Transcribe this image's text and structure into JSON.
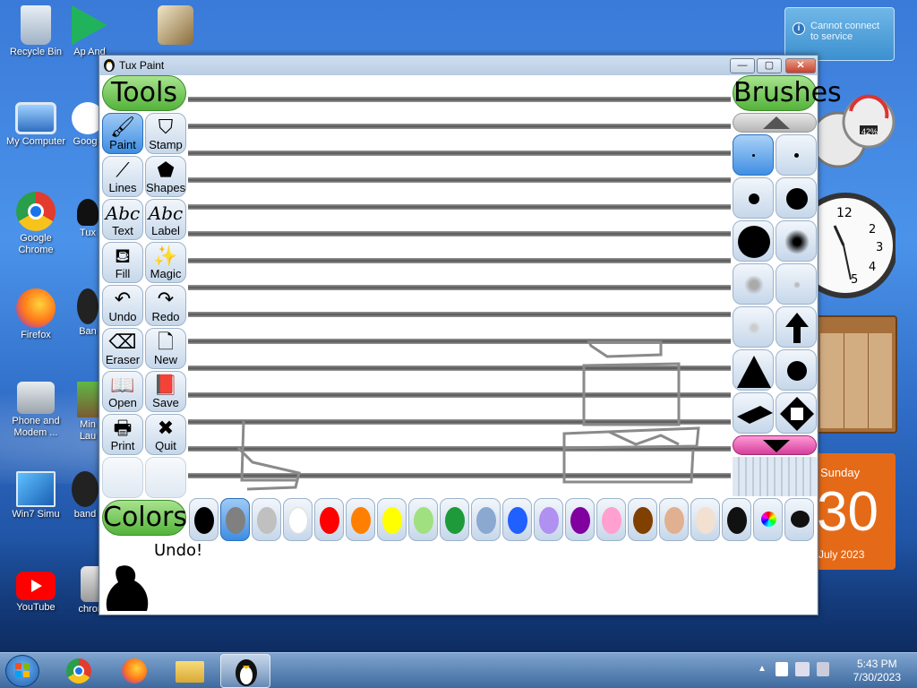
{
  "desktop": {
    "icons": [
      {
        "label": "Recycle Bin"
      },
      {
        "label": "Ap And"
      },
      {
        "label": "My Computer"
      },
      {
        "label": "Goog"
      },
      {
        "label": "Google Chrome"
      },
      {
        "label": "Tux"
      },
      {
        "label": "Firefox"
      },
      {
        "label": "Ban"
      },
      {
        "label": "Phone and Modem ..."
      },
      {
        "label": "Min Lau"
      },
      {
        "label": "Win7 Simu"
      },
      {
        "label": "band"
      },
      {
        "label": "YouTube"
      },
      {
        "label": "chromium-..."
      }
    ],
    "balloon": {
      "text": "Cannot connect to service",
      "icon": "info-icon"
    },
    "calendar": {
      "day": "Sunday",
      "date": "30",
      "month": "July 2023"
    },
    "cpu_meter": {
      "value": "42%"
    }
  },
  "window": {
    "title": "Tux Paint",
    "controls": {
      "minimize": "—",
      "maximize": "▢",
      "close": "✕"
    }
  },
  "tuxpaint": {
    "tools_header": "Tools",
    "brushes_header": "Brushes",
    "colors_header": "Colors",
    "tools": [
      {
        "label": "Paint",
        "icon": "paintbrush-icon",
        "glyph": "🖌",
        "selected": true
      },
      {
        "label": "Stamp",
        "icon": "stamp-icon",
        "glyph": "⛉"
      },
      {
        "label": "Lines",
        "icon": "lines-icon",
        "glyph": "⟋"
      },
      {
        "label": "Shapes",
        "icon": "pentagon-icon",
        "glyph": "⬟"
      },
      {
        "label": "Text",
        "icon": "text-icon",
        "glyph": "Abc"
      },
      {
        "label": "Label",
        "icon": "label-icon",
        "glyph": "Abc"
      },
      {
        "label": "Fill",
        "icon": "paint-bucket-icon",
        "glyph": "⛾"
      },
      {
        "label": "Magic",
        "icon": "magic-wand-icon",
        "glyph": "✨"
      },
      {
        "label": "Undo",
        "icon": "undo-icon",
        "glyph": "↶"
      },
      {
        "label": "Redo",
        "icon": "redo-icon",
        "glyph": "↷"
      },
      {
        "label": "Eraser",
        "icon": "eraser-icon",
        "glyph": "⌫"
      },
      {
        "label": "New",
        "icon": "new-page-icon",
        "glyph": "🗋"
      },
      {
        "label": "Open",
        "icon": "open-book-icon",
        "glyph": "📖"
      },
      {
        "label": "Save",
        "icon": "save-book-icon",
        "glyph": "📕"
      },
      {
        "label": "Print",
        "icon": "printer-icon",
        "glyph": "🖶"
      },
      {
        "label": "Quit",
        "icon": "quit-icon",
        "glyph": "✖"
      }
    ],
    "colors": [
      {
        "name": "black",
        "hex": "#000000"
      },
      {
        "name": "gray",
        "hex": "#808080",
        "selected": true
      },
      {
        "name": "silver",
        "hex": "#c0c0c0"
      },
      {
        "name": "white",
        "hex": "#ffffff"
      },
      {
        "name": "red",
        "hex": "#ff0000"
      },
      {
        "name": "orange",
        "hex": "#ff8000"
      },
      {
        "name": "yellow",
        "hex": "#ffff00"
      },
      {
        "name": "light-green",
        "hex": "#a0e080"
      },
      {
        "name": "green",
        "hex": "#1e9a3a"
      },
      {
        "name": "sky-blue",
        "hex": "#8aa8d0"
      },
      {
        "name": "blue",
        "hex": "#2060ff"
      },
      {
        "name": "lavender",
        "hex": "#b090f0"
      },
      {
        "name": "purple",
        "hex": "#8000a0"
      },
      {
        "name": "pink",
        "hex": "#ffa0d0"
      },
      {
        "name": "brown",
        "hex": "#804000"
      },
      {
        "name": "tan",
        "hex": "#e0b090"
      },
      {
        "name": "beige",
        "hex": "#f2e0d0"
      }
    ],
    "status_message": "Undo!"
  },
  "taskbar": {
    "time": "5:43 PM",
    "date": "7/30/2023"
  }
}
